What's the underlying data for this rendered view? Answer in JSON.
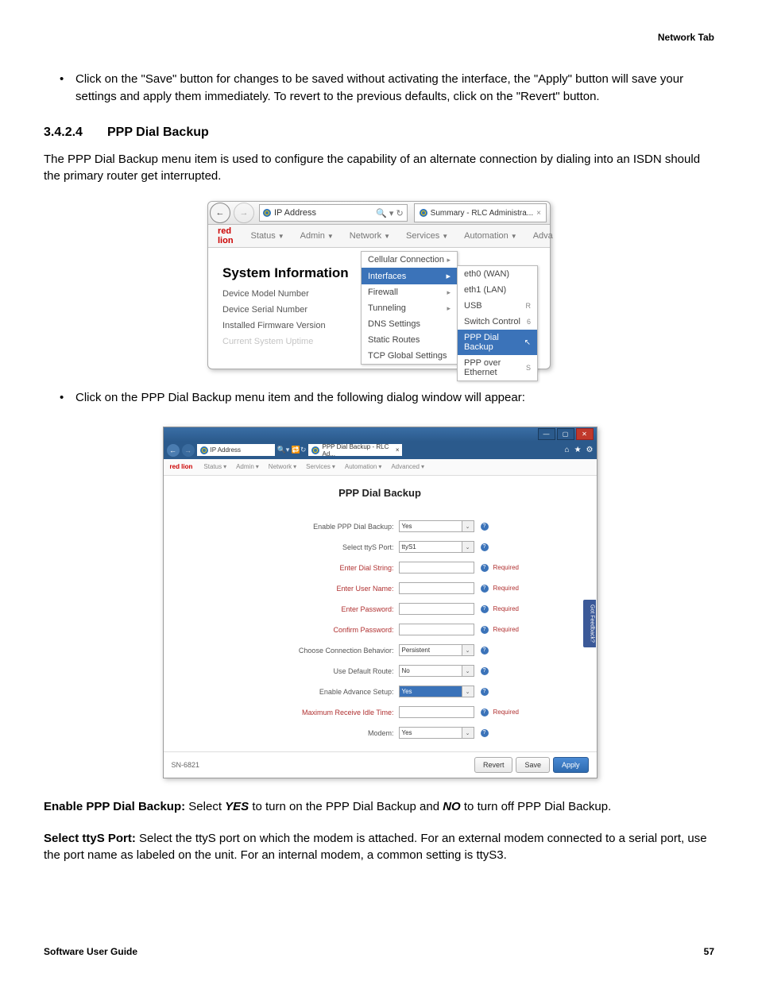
{
  "header": {
    "section": "Network Tab"
  },
  "intro_bullet": "Click on the \"Save\" button for changes to be saved without activating the interface, the \"Apply\" button will save your settings and apply them immediately. To revert to the previous defaults, click on the \"Revert\" button.",
  "section": {
    "number": "3.4.2.4",
    "title": "PPP Dial Backup"
  },
  "section_para": "The PPP Dial Backup menu item is used to configure the capability of an alternate connection by dialing into an ISDN should the primary router get interrupted.",
  "fig1": {
    "address": "IP Address",
    "tab": "Summary - RLC Administra...",
    "brand": "red lion",
    "menu": {
      "status": "Status",
      "admin": "Admin",
      "network": "Network",
      "services": "Services",
      "automation": "Automation",
      "adva": "Adva"
    },
    "sys_title": "System Information",
    "rows": {
      "model": "Device Model Number",
      "serial": "Device Serial Number",
      "fw": "Installed Firmware Version",
      "uptime": "Current System Uptime"
    },
    "dd1": [
      "Cellular Connection",
      "Interfaces",
      "Firewall",
      "Tunneling",
      "DNS Settings",
      "Static Routes",
      "TCP Global Settings"
    ],
    "dd2": [
      "eth0 (WAN)",
      "eth1 (LAN)",
      "USB",
      "Switch Control",
      "PPP Dial Backup",
      "PPP over Ethernet"
    ],
    "dd2_side": {
      "r": "R",
      "six": "6",
      "s": "S"
    }
  },
  "mid_bullet": "Click on the PPP Dial Backup menu item and the following dialog window will appear:",
  "fig2": {
    "address": "IP Address",
    "tab": "PPP Dial Backup - RLC Ad...",
    "brand": "red lion",
    "menu": {
      "status": "Status",
      "admin": "Admin",
      "network": "Network",
      "services": "Services",
      "automation": "Automation",
      "advanced": "Advanced"
    },
    "title": "PPP Dial Backup",
    "side_tab": "Got Feedback?",
    "fields": {
      "enable": {
        "label": "Enable PPP Dial Backup:",
        "value": "Yes",
        "type": "select"
      },
      "ttys": {
        "label": "Select ttyS Port:",
        "value": "ttyS1",
        "type": "select"
      },
      "dial": {
        "label": "Enter Dial String:",
        "value": "",
        "type": "text",
        "required": true
      },
      "user": {
        "label": "Enter User Name:",
        "value": "",
        "type": "text",
        "required": true
      },
      "pass": {
        "label": "Enter Password:",
        "value": "",
        "type": "text",
        "required": true
      },
      "cpass": {
        "label": "Confirm Password:",
        "value": "",
        "type": "text",
        "required": true
      },
      "behavior": {
        "label": "Choose Connection Behavior:",
        "value": "Persistent",
        "type": "select"
      },
      "route": {
        "label": "Use Default Route:",
        "value": "No",
        "type": "select"
      },
      "adv": {
        "label": "Enable Advance Setup:",
        "value": "Yes",
        "type": "select",
        "highlight": true
      },
      "idle": {
        "label": "Maximum Receive Idle Time:",
        "value": "",
        "type": "text",
        "required": true
      },
      "modem": {
        "label": "Modem:",
        "value": "Yes",
        "type": "select"
      }
    },
    "model": "SN-6821",
    "buttons": {
      "revert": "Revert",
      "save": "Save",
      "apply": "Apply"
    }
  },
  "desc": {
    "enable": {
      "bold": "Enable PPP Dial Backup: ",
      "rest": "Select ",
      "yes": "YES",
      "mid": " to turn on the PPP Dial Backup and ",
      "no": "NO",
      "end": " to turn off PPP Dial Backup."
    },
    "ttys": {
      "bold": "Select ttyS Port: ",
      "rest": "Select the ttyS port on which the modem is attached. For an external modem connected to a serial port, use the port name as labeled on the unit. For an internal modem, a common setting is ttyS3."
    }
  },
  "footer": {
    "left": "Software User Guide",
    "right": "57"
  }
}
